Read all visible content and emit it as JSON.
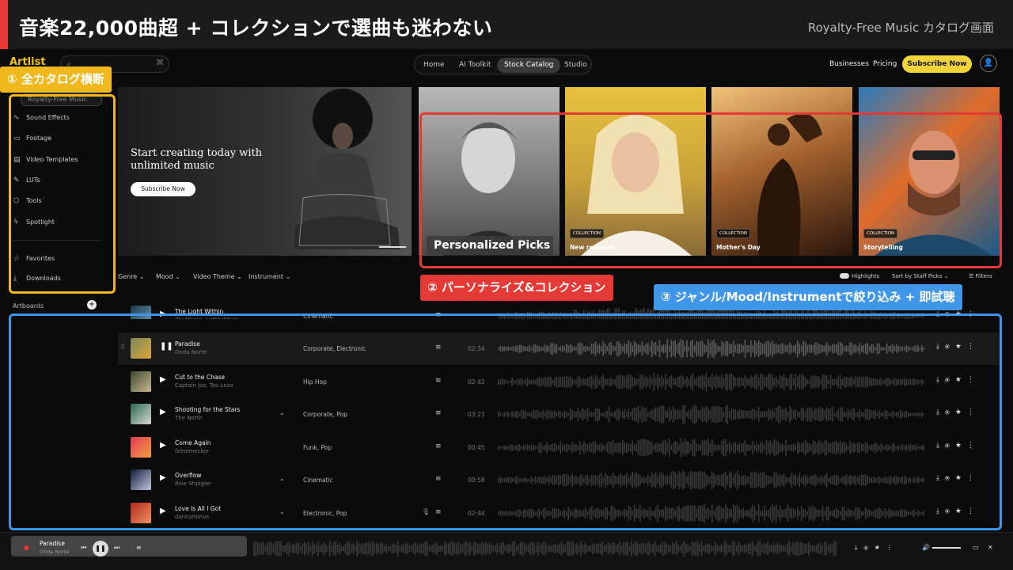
{
  "slide": {
    "title": "音楽22,000曲超 + コレクションで選曲も迷わない",
    "subtitle": "Royalty-Free Music カタログ画面"
  },
  "header": {
    "brand": "Artlist",
    "nav_tabs": [
      "Home",
      "AI Toolkit",
      "Stock Catalog",
      "Studio"
    ],
    "active_tab": "Stock Catalog",
    "links": [
      "Businesses",
      "Pricing"
    ],
    "subscribe_label": "Subscribe Now"
  },
  "sidebar": {
    "selected": "Royalty-Free Music",
    "items": [
      "Sound Effects",
      "Footage",
      "Video Templates",
      "LUTs",
      "Tools",
      "Spotlight"
    ],
    "bottom_items": [
      "Favorites",
      "Downloads"
    ],
    "artboards_label": "Artboards"
  },
  "hero": {
    "title": "Start creating today with unlimited music",
    "button": "Subscribe Now"
  },
  "collections": [
    {
      "label": "Personalized Picks",
      "badge": ""
    },
    {
      "label": "New releases",
      "badge": "COLLECTION"
    },
    {
      "label": "Mother's Day",
      "badge": "COLLECTION"
    },
    {
      "label": "Storytelling",
      "badge": "COLLECTION"
    }
  ],
  "filters": {
    "items": [
      "Genre",
      "Mood",
      "Video Theme",
      "Instrument"
    ],
    "highlights": "Highlights",
    "sort": "Sort by Staff Picks",
    "filters": "Filters"
  },
  "tracks": [
    {
      "name": "The Light Within",
      "artist": "Ziv Moran, Light Whale",
      "genre": "Cinematic",
      "duration": "",
      "expand": false
    },
    {
      "name": "Paradise",
      "artist": "Onda Norte",
      "genre": "Corporate, Electronic",
      "duration": "02:34",
      "expand": false
    },
    {
      "name": "Cut to the Chase",
      "artist": "Captain Joz, Teo Leza",
      "genre": "Hip Hop",
      "duration": "02:42",
      "expand": false
    },
    {
      "name": "Shooting for the Stars",
      "artist": "The North",
      "genre": "Corporate, Pop",
      "duration": "03:21",
      "expand": true
    },
    {
      "name": "Come Again",
      "artist": "felnemecker",
      "genre": "Funk, Pop",
      "duration": "00:45",
      "expand": false
    },
    {
      "name": "Overflow",
      "artist": "Roie Shpigler",
      "genre": "Cinematic",
      "duration": "00:58",
      "expand": true
    },
    {
      "name": "Love Is All I Got",
      "artist": "dannyminus",
      "genre": "Electronic, Pop",
      "duration": "02:44",
      "expand": true
    }
  ],
  "player": {
    "track": "Paradise",
    "artist": "Onda Norte"
  },
  "annotations": {
    "a1": "① 全カタログ横断",
    "a2": "② パーソナライズ&コレクション",
    "a3": "③ ジャンル/Mood/Instrumentで絞り込み + 即試聴"
  },
  "colors": {
    "accent_red": "#e53935",
    "accent_yellow": "#f0b81c",
    "accent_blue": "#4096e8",
    "subscribe": "#f2d43a"
  }
}
